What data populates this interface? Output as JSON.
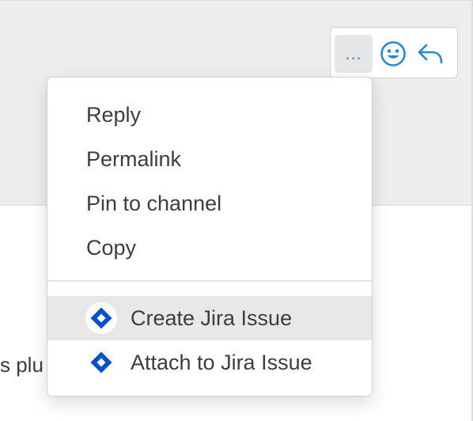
{
  "post": {
    "text_fragment": "s plu"
  },
  "toolbar": {
    "more_label": "...",
    "icons": {
      "emoji": "smiley-face-icon",
      "reply": "reply-arrow-icon"
    },
    "accent_color": "#2389d7"
  },
  "menu": {
    "items": [
      {
        "label": "Reply"
      },
      {
        "label": "Permalink"
      },
      {
        "label": "Pin to channel"
      },
      {
        "label": "Copy"
      }
    ],
    "plugin_items": [
      {
        "label": "Create Jira Issue",
        "icon": "jira-icon",
        "highlighted": true
      },
      {
        "label": "Attach to Jira Issue",
        "icon": "jira-icon",
        "highlighted": false
      }
    ],
    "jira_color": "#0052cc"
  }
}
